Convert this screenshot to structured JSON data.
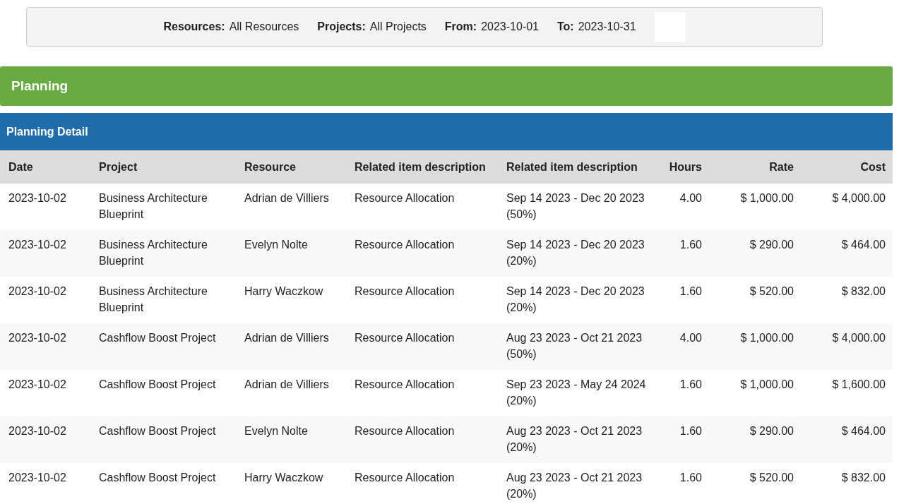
{
  "filters": [
    {
      "label": "Resources:",
      "value": "All Resources"
    },
    {
      "label": "Projects:",
      "value": "All Projects"
    },
    {
      "label": "From:",
      "value": "2023-10-01"
    },
    {
      "label": "To:",
      "value": "2023-10-31"
    }
  ],
  "section": {
    "title": "Planning"
  },
  "panel": {
    "title": "Planning Detail"
  },
  "table": {
    "columns": [
      "Date",
      "Project",
      "Resource",
      "Related item description",
      "Related item description",
      "Hours",
      "Rate",
      "Cost"
    ],
    "rows": [
      [
        "2023-10-02",
        "Business Architecture Blueprint",
        "Adrian de Villiers",
        "Resource Allocation",
        "Sep 14 2023 - Dec 20 2023 (50%)",
        "4.00",
        "$ 1,000.00",
        "$ 4,000.00"
      ],
      [
        "2023-10-02",
        "Business Architecture Blueprint",
        "Evelyn Nolte",
        "Resource Allocation",
        "Sep 14 2023 - Dec 20 2023 (20%)",
        "1.60",
        "$ 290.00",
        "$ 464.00"
      ],
      [
        "2023-10-02",
        "Business Architecture Blueprint",
        "Harry Waczkow",
        "Resource Allocation",
        "Sep 14 2023 - Dec 20 2023 (20%)",
        "1.60",
        "$ 520.00",
        "$ 832.00"
      ],
      [
        "2023-10-02",
        "Cashflow Boost Project",
        "Adrian de Villiers",
        "Resource Allocation",
        "Aug 23 2023 - Oct 21 2023 (50%)",
        "4.00",
        "$ 1,000.00",
        "$ 4,000.00"
      ],
      [
        "2023-10-02",
        "Cashflow Boost Project",
        "Adrian de Villiers",
        "Resource Allocation",
        "Sep 23 2023 - May 24 2024 (20%)",
        "1.60",
        "$ 1,000.00",
        "$ 1,600.00"
      ],
      [
        "2023-10-02",
        "Cashflow Boost Project",
        "Evelyn Nolte",
        "Resource Allocation",
        "Aug 23 2023 - Oct 21 2023 (20%)",
        "1.60",
        "$ 290.00",
        "$ 464.00"
      ],
      [
        "2023-10-02",
        "Cashflow Boost Project",
        "Harry Waczkow",
        "Resource Allocation",
        "Aug 23 2023 - Oct 21 2023 (20%)",
        "1.60",
        "$ 520.00",
        "$ 832.00"
      ]
    ]
  }
}
